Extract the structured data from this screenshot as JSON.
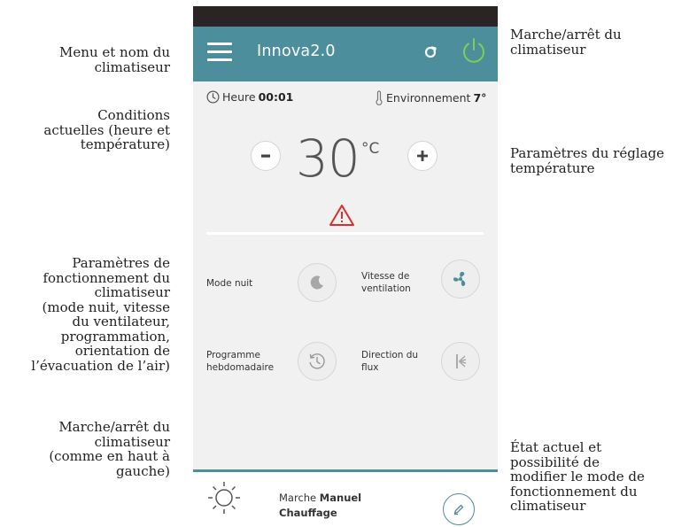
{
  "annotations": {
    "menu": [
      "Menu et nom du",
      "climatiseur"
    ],
    "conditions": [
      "Conditions",
      "actuelles (heure et",
      "température)"
    ],
    "params": [
      "Paramètres de",
      "fonctionnement du",
      "climatiseur",
      "(mode nuit, vitesse",
      "du ventilateur,",
      "programmation,",
      "orientation de",
      "l’évacuation de l’air)"
    ],
    "power_bottom": [
      "Marche/arrêt du",
      "climatiseur",
      "(comme en haut à",
      "gauche)"
    ],
    "power_top": [
      "Marche/arrêt du",
      "climatiseur"
    ],
    "temp_settings": [
      "Paramètres du réglage",
      "température"
    ],
    "mode_state": [
      "État actuel et",
      "possibilité de",
      "modifier le mode de",
      "fonctionnement du",
      "climatiseur"
    ]
  },
  "app": {
    "title": "Innova2.0",
    "icons": {
      "menu": "hamburger-icon",
      "refresh": "refresh-icon",
      "power": "power-icon"
    },
    "accent_color": "#4c8e9c",
    "power_color": "#7ccf52"
  },
  "conditions": {
    "time_label": "Heure",
    "time_value": "00:01",
    "env_label": "Environnement",
    "env_value": "7°"
  },
  "temperature": {
    "minus_label": "-",
    "plus_label": "+",
    "value": "30",
    "unit": "°C"
  },
  "params": {
    "night_mode": [
      "Mode nuit"
    ],
    "fan_speed": [
      "Vitesse de",
      "ventilation"
    ],
    "weekly_program": [
      "Programme",
      "hebdomadaire"
    ],
    "flow_direction": [
      "Direction du",
      "flux"
    ]
  },
  "status": {
    "line1_prefix": "Marche",
    "line1_mode": "Manuel",
    "line2": "Chauffage"
  }
}
